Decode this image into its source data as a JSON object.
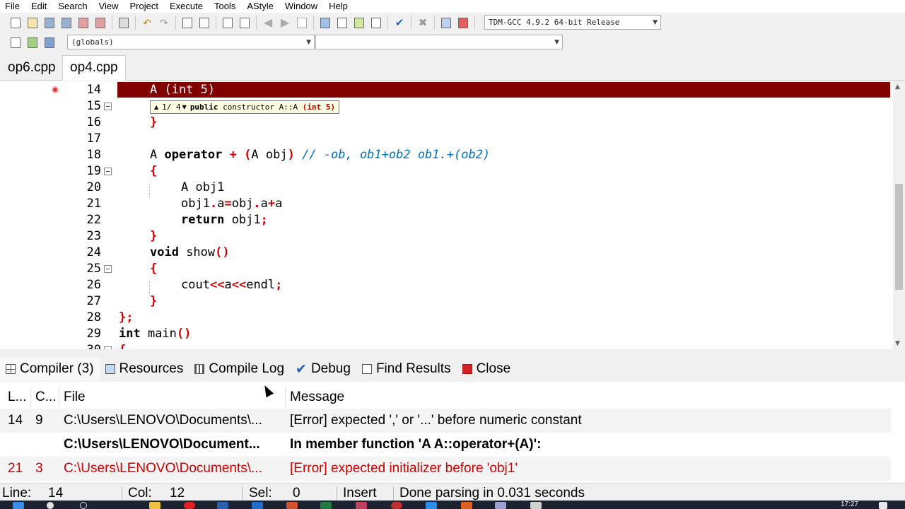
{
  "menu": [
    "File",
    "Edit",
    "Search",
    "View",
    "Project",
    "Execute",
    "Tools",
    "AStyle",
    "Window",
    "Help"
  ],
  "toolbar": {
    "compiler_select": "TDM-GCC 4.9.2 64-bit Release",
    "scope_select": "(globals)",
    "function_select": ""
  },
  "tabs": [
    {
      "label": "op6.cpp",
      "active": false
    },
    {
      "label": "op4.cpp",
      "active": true
    }
  ],
  "editor": {
    "tooltip": {
      "index": "1/ 4",
      "text": "public constructor A::A (int 5)"
    },
    "lines": [
      {
        "num": "14",
        "text": "A (int 5)"
      },
      {
        "num": "15",
        "text": ""
      },
      {
        "num": "16",
        "text": "}"
      },
      {
        "num": "17",
        "text": ""
      },
      {
        "num": "18",
        "text": "A operator + (A obj) // -ob, ob1+ob2 ob1.+(ob2)"
      },
      {
        "num": "19",
        "text": "{"
      },
      {
        "num": "20",
        "text": "A obj1"
      },
      {
        "num": "21",
        "text": "obj1.a=obj.a+a"
      },
      {
        "num": "22",
        "text": "return obj1;"
      },
      {
        "num": "23",
        "text": "}"
      },
      {
        "num": "24",
        "text": "void show()"
      },
      {
        "num": "25",
        "text": "{"
      },
      {
        "num": "26",
        "text": "cout<<a<<endl;"
      },
      {
        "num": "27",
        "text": "}"
      },
      {
        "num": "28",
        "text": "};"
      },
      {
        "num": "29",
        "text": "int main()"
      },
      {
        "num": "30",
        "text": "{"
      }
    ],
    "error_line": "14",
    "colors": {
      "error_line_bg": "#800000",
      "symbol": "#d40000",
      "comment": "#0070c0"
    }
  },
  "panel_tabs": [
    {
      "label": "Compiler (3)",
      "icon": "grid-icon"
    },
    {
      "label": "Resources",
      "icon": "resources-icon"
    },
    {
      "label": "Compile Log",
      "icon": "chart-icon"
    },
    {
      "label": "Debug",
      "icon": "check-icon"
    },
    {
      "label": "Find Results",
      "icon": "find-icon"
    },
    {
      "label": "Close",
      "icon": "close-icon"
    }
  ],
  "messages": {
    "columns": [
      "L...",
      "C...",
      "File",
      "Message"
    ],
    "rows": [
      {
        "line": "14",
        "col": "9",
        "file": "C:\\Users\\LENOVO\\Documents\\...",
        "message": "[Error] expected ',' or '...' before numeric constant"
      },
      {
        "line": "",
        "col": "",
        "file": "C:\\Users\\LENOVO\\Document...",
        "message": "In member function 'A A::operator+(A)':"
      },
      {
        "line": "21",
        "col": "3",
        "file": "C:\\Users\\LENOVO\\Documents\\...",
        "message": "[Error] expected initializer before 'obj1'"
      }
    ]
  },
  "status": {
    "line_label": "Line:",
    "line_value": "14",
    "col_label": "Col:",
    "col_value": "12",
    "sel_label": "Sel:",
    "sel_value": "0",
    "mode": "Insert",
    "message": "Done parsing in 0.031 seconds"
  },
  "taskbar": {
    "clock": "17:27"
  }
}
